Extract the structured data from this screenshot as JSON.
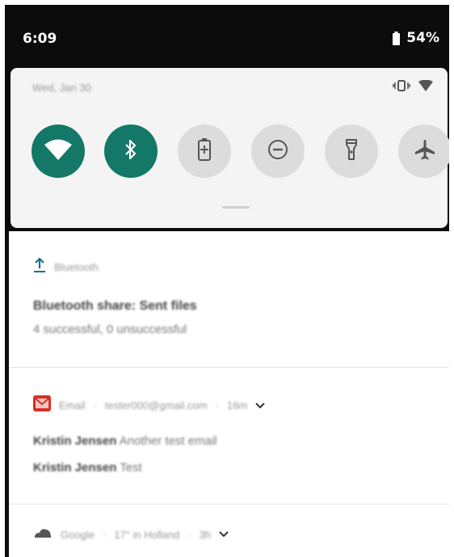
{
  "status_bar": {
    "time": "6:09",
    "battery_percent": "54%"
  },
  "quick_settings": {
    "date": "Wed, Jan 30",
    "tiles": [
      {
        "icon": "wifi-icon",
        "state": "on"
      },
      {
        "icon": "bluetooth-icon",
        "state": "on"
      },
      {
        "icon": "battery-saver-icon",
        "state": "off"
      },
      {
        "icon": "do-not-disturb-icon",
        "state": "off"
      },
      {
        "icon": "flashlight-icon",
        "state": "off"
      },
      {
        "icon": "airplane-mode-icon",
        "state": "off"
      }
    ],
    "colors": {
      "tile_on": "#137867",
      "tile_off": "#dcdcdc"
    }
  },
  "notifications": [
    {
      "app": "Bluetooth",
      "icon": "upload-icon",
      "title": "Bluetooth share: Sent files",
      "text": "4 successful, 0 unsuccessful"
    },
    {
      "app": "Email",
      "account": "tester000@gmail.com",
      "time": "16m",
      "icon": "email-icon",
      "lines": [
        {
          "sender": "Kristin Jensen",
          "text": "Another test email"
        },
        {
          "sender": "Kristin Jensen",
          "text": "Test"
        }
      ]
    },
    {
      "app": "Google",
      "detail": "17° in Holland",
      "time": "3h",
      "icon": "cloud-icon"
    }
  ]
}
